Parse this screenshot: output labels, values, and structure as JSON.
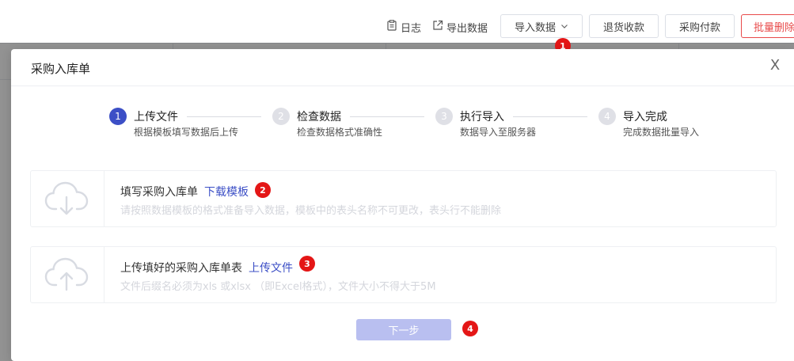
{
  "toolbar": {
    "log_label": "日志",
    "export_label": "导出数据",
    "import_label": "导入数据",
    "return_label": "退货收款",
    "purchase_pay_label": "采购付款",
    "batch_delete_label": "批量删除"
  },
  "modal": {
    "title": "采购入库单",
    "close": "X"
  },
  "steps": [
    {
      "number": "1",
      "label": "上传文件",
      "desc": "根据模板填写数据后上传"
    },
    {
      "number": "2",
      "label": "检查数据",
      "desc": "检查数据格式准确性"
    },
    {
      "number": "3",
      "label": "执行导入",
      "desc": "数据导入至服务器"
    },
    {
      "number": "4",
      "label": "导入完成",
      "desc": "完成数据批量导入"
    }
  ],
  "cards": {
    "download": {
      "title": "填写采购入库单",
      "link": "下载模板",
      "hint": "请按照数据模板的格式准备导入数据，模板中的表头名称不可更改，表头行不能删除"
    },
    "upload": {
      "title": "上传填好的采购入库单表",
      "link": "上传文件",
      "hint": "文件后缀名必须为xls 或xlsx （即Excel格式），文件大小不得大于5M"
    }
  },
  "next_button": "下一步",
  "badges": [
    "1",
    "2",
    "3",
    "4"
  ],
  "colors": {
    "primary": "#3c4fc6",
    "badge": "#e41616",
    "danger": "#e84a4a",
    "disabled_button": "#b9bff0"
  },
  "icons": [
    "document-icon",
    "export-icon",
    "chevron-down-icon",
    "close-icon",
    "cloud-download-icon",
    "cloud-upload-icon"
  ]
}
